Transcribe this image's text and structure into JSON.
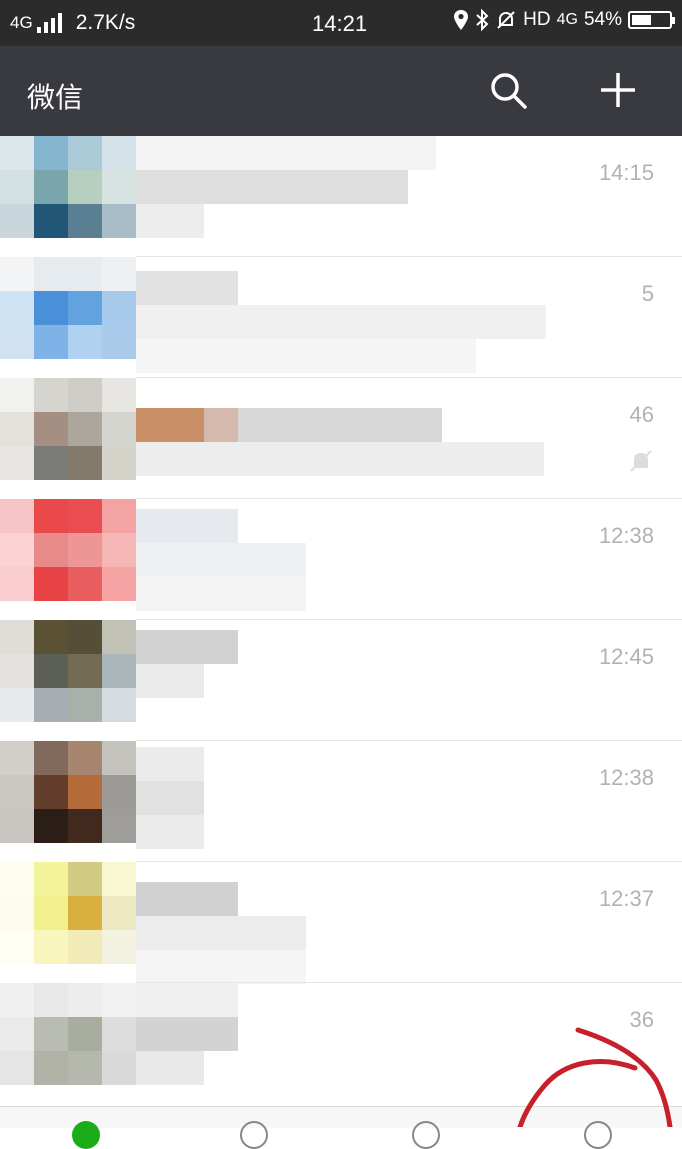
{
  "status_bar": {
    "network": "4G",
    "speed": "2.7K/s",
    "time": "14:21",
    "indicators": "HD",
    "network_right": "4G",
    "battery_text": "54%",
    "battery_level": 0.54
  },
  "header": {
    "title": "微信",
    "search_icon": "search-icon",
    "add_icon": "plus-icon"
  },
  "chats": [
    {
      "time": "14:15",
      "muted": false
    },
    {
      "time": "5",
      "muted": false
    },
    {
      "time": "46",
      "muted": true
    },
    {
      "time": "12:38",
      "muted": false
    },
    {
      "time": "12:45",
      "muted": false
    },
    {
      "time": "12:38",
      "muted": false
    },
    {
      "time": "12:37",
      "muted": false
    },
    {
      "time": "36",
      "muted": false
    }
  ],
  "colors": {
    "status_bar_bg": "#2b2b2b",
    "header_bg": "#393a3f",
    "time_text": "#b2b2b2",
    "annotation_red": "#c8202a",
    "wechat_green": "#1aad19"
  }
}
